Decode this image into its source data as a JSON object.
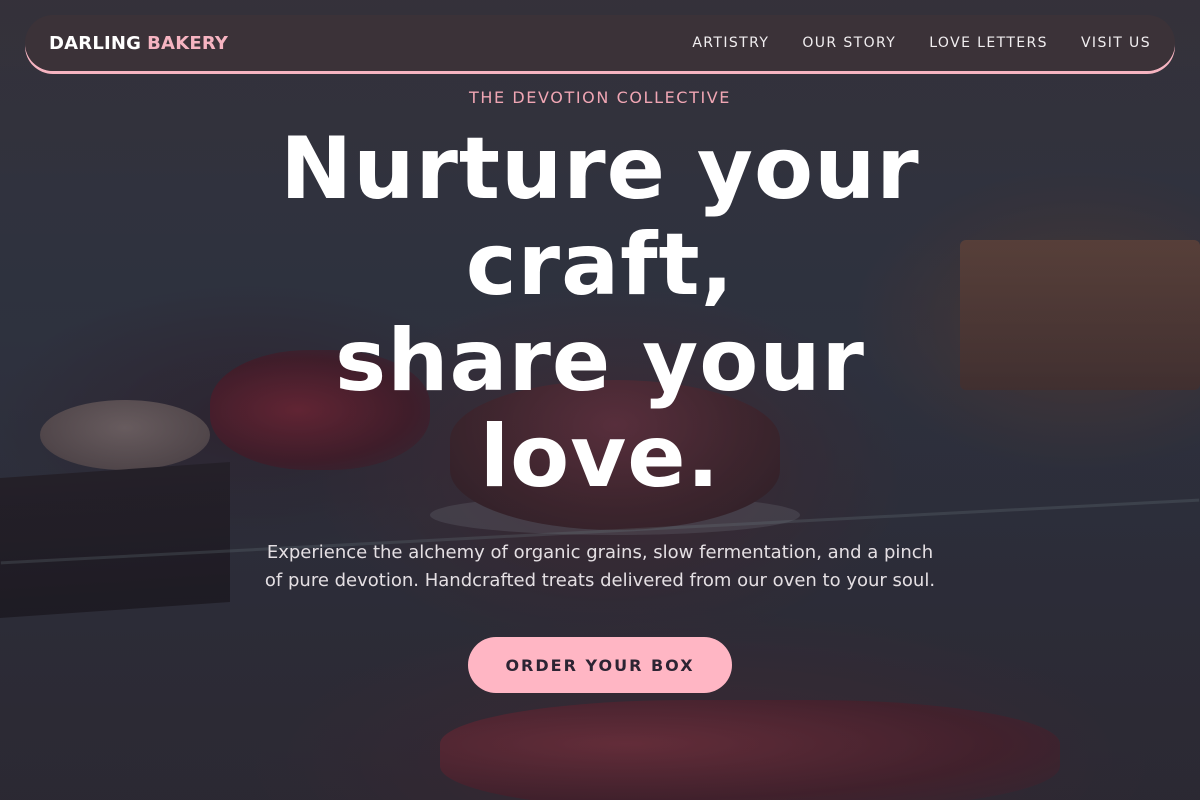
{
  "nav": {
    "brand_primary": "DARLING",
    "brand_accent": "BAKERY",
    "links": [
      {
        "label": "ARTISTRY"
      },
      {
        "label": "OUR STORY"
      },
      {
        "label": "LOVE LETTERS"
      },
      {
        "label": "VISIT US"
      }
    ]
  },
  "hero": {
    "eyebrow": "THE DEVOTION COLLECTIVE",
    "headline_line1": "Nurture your craft,",
    "headline_line2": "share your love.",
    "subtitle": "Experience the alchemy of organic grains, slow fermentation, and a pinch of pure devotion. Handcrafted treats delivered from our oven to your soul.",
    "cta_label": "ORDER YOUR BOX",
    "background": "bakery display case with cakes, berries and tarts"
  },
  "colors": {
    "accent_pink": "#f6b4c1",
    "cta_background": "#ffb6c4",
    "eyebrow": "#f0a6b4",
    "cta_text": "#2c2433",
    "headline": "#ffffff"
  }
}
